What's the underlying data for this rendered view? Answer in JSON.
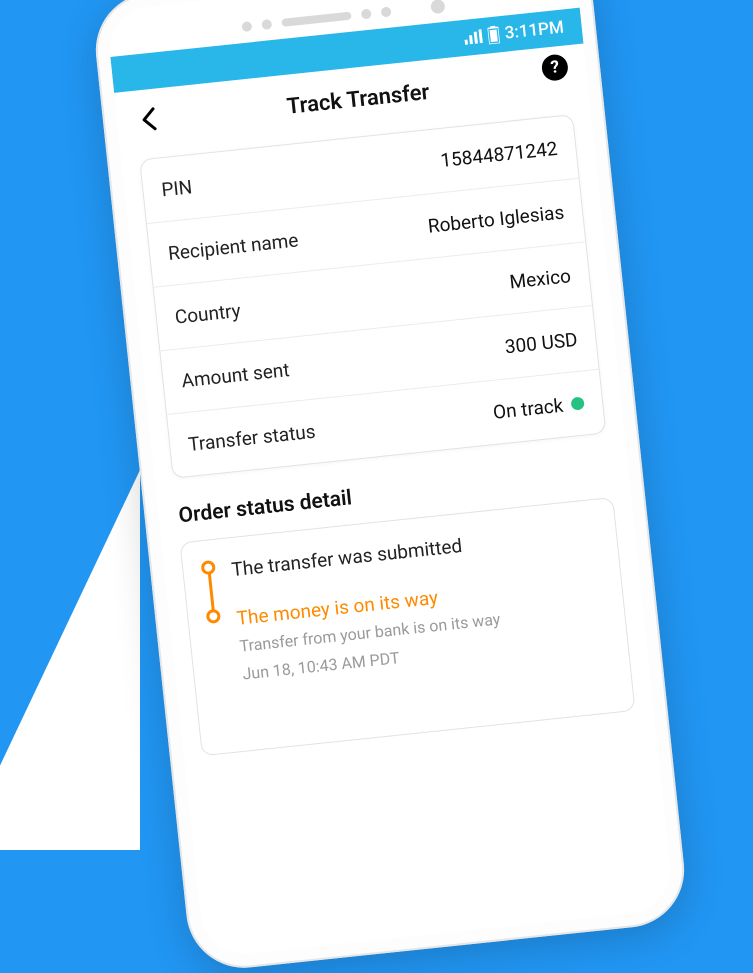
{
  "status_bar": {
    "time": "3:11PM"
  },
  "header": {
    "title": "Track Transfer"
  },
  "details": {
    "rows": [
      {
        "label": "PIN",
        "value": "15844871242"
      },
      {
        "label": "Recipient name",
        "value": "Roberto Iglesias"
      },
      {
        "label": "Country",
        "value": "Mexico"
      },
      {
        "label": "Amount sent",
        "value": "300 USD"
      },
      {
        "label": "Transfer status",
        "value": "On track"
      }
    ]
  },
  "section_title": "Order status detail",
  "timeline": [
    {
      "title": "The transfer was submitted",
      "active": false
    },
    {
      "title": "The money is on its way",
      "active": true,
      "subtitle": "Transfer from your bank is on its way",
      "timestamp": "Jun 18, 10:43 AM PDT"
    }
  ],
  "colors": {
    "accent": "#29b6e8",
    "highlight": "#ff8a00",
    "status_ok": "#26c281"
  }
}
